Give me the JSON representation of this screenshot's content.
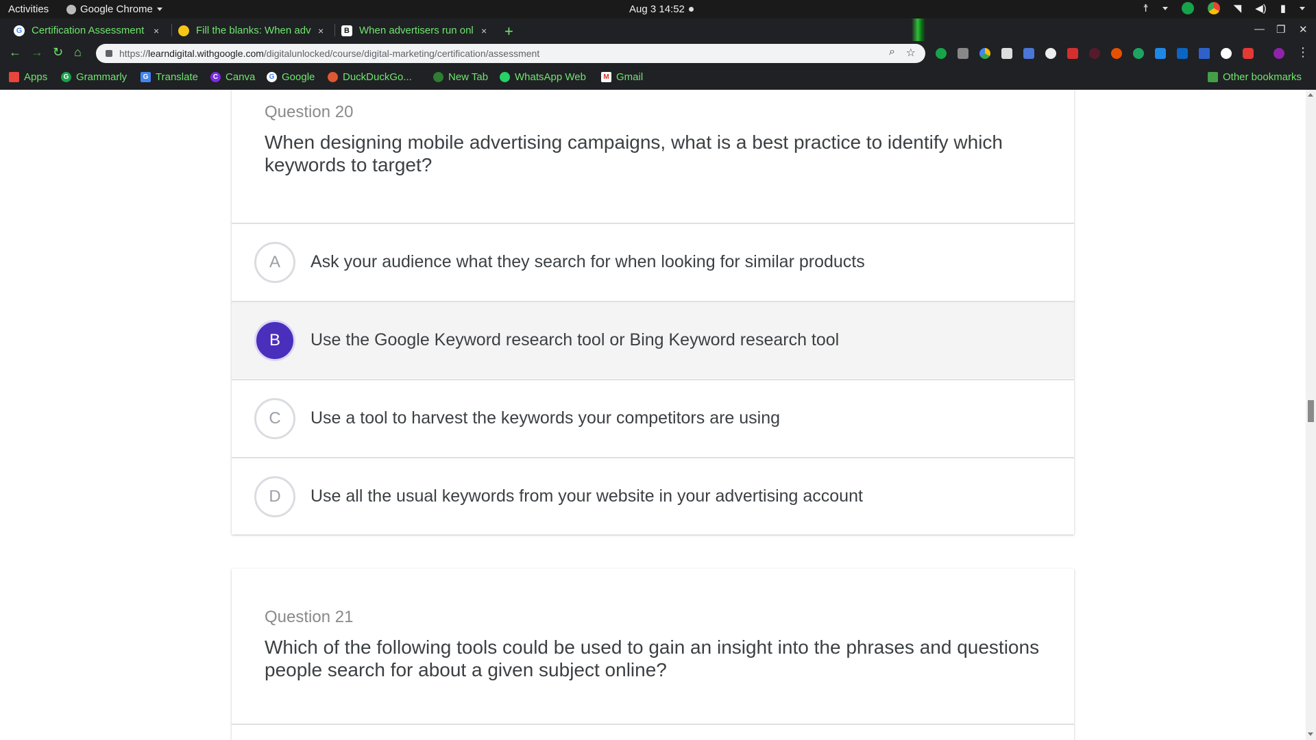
{
  "topbar": {
    "activities": "Activities",
    "app_name": "Google Chrome",
    "clock": "Aug 3  14:52"
  },
  "tabs": [
    {
      "title": "Certification Assessment",
      "close": "×"
    },
    {
      "title": "Fill the blanks: When adv",
      "close": "×"
    },
    {
      "title": "When advertisers run onl",
      "close": "×"
    }
  ],
  "new_tab_symbol": "+",
  "address": {
    "scheme": "https://",
    "host": "learndigital.withgoogle.com",
    "path": "/digitalunlocked/course/digital-marketing/certification/assessment"
  },
  "bookmarks": [
    {
      "label": "Apps"
    },
    {
      "label": "Grammarly"
    },
    {
      "label": "Translate"
    },
    {
      "label": "Canva"
    },
    {
      "label": "Google"
    },
    {
      "label": "DuckDuckGo..."
    },
    {
      "label": "New Tab"
    },
    {
      "label": "WhatsApp Web"
    },
    {
      "label": "Gmail"
    }
  ],
  "other_bookmarks": "Other bookmarks",
  "questions": [
    {
      "number": "Question 20",
      "text": "When designing mobile advertising campaigns, what is a best practice to identify which keywords to target?",
      "options": [
        {
          "letter": "A",
          "text": "Ask your audience what they search for when looking for similar products",
          "selected": false
        },
        {
          "letter": "B",
          "text": "Use the Google Keyword research tool or Bing Keyword research tool",
          "selected": true
        },
        {
          "letter": "C",
          "text": "Use a tool to harvest the keywords your competitors are using",
          "selected": false
        },
        {
          "letter": "D",
          "text": "Use all the usual keywords from your website in your advertising account",
          "selected": false
        }
      ]
    },
    {
      "number": "Question 21",
      "text": "Which of the following tools could be used to gain an insight into the phrases and questions people search for about a given subject online?"
    }
  ],
  "colors": {
    "selected_option_circle": "#4a2fbd",
    "chrome_theme_accent": "#6ee66e",
    "chrome_frame": "#202124"
  }
}
